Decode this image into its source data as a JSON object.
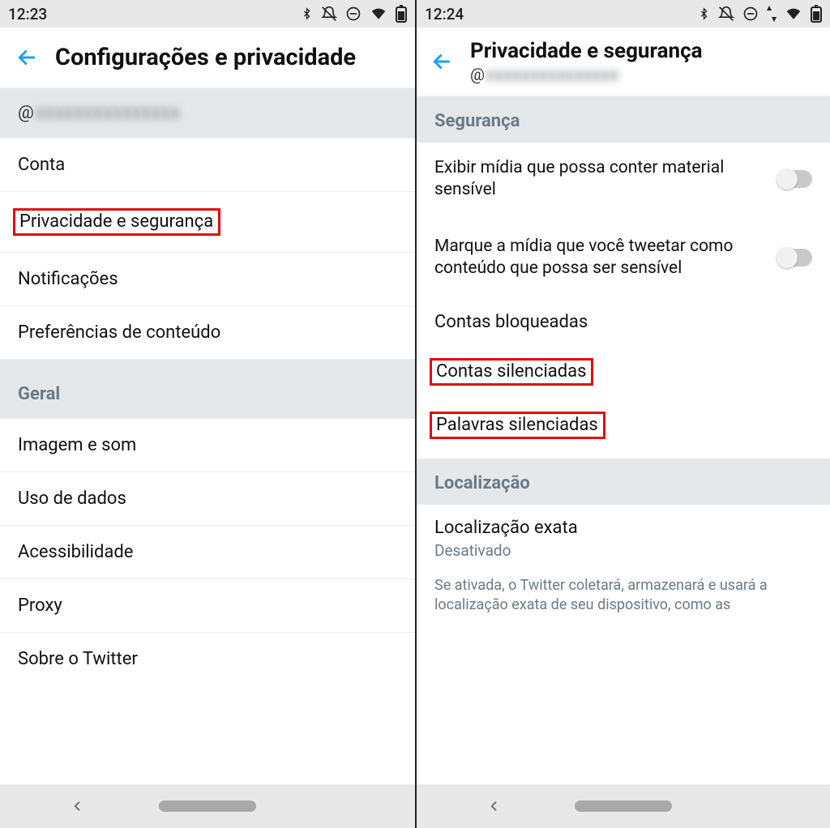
{
  "left": {
    "status_time": "12:23",
    "title": "Configurações e privacidade",
    "username_at": "@",
    "username_blur": "xxxxxxxxxxxxxxx",
    "items": {
      "conta": "Conta",
      "privacidade": "Privacidade e segurança",
      "notificacoes": "Notificações",
      "preferencias": "Preferências de conteúdo"
    },
    "section_geral": "Geral",
    "geral_items": {
      "imagem": "Imagem e som",
      "dados": "Uso de dados",
      "acessibilidade": "Acessibilidade",
      "proxy": "Proxy",
      "sobre": "Sobre o Twitter"
    }
  },
  "right": {
    "status_time": "12:24",
    "title": "Privacidade e segurança",
    "username_at": "@",
    "username_blur": "xxxxxxxxxxxxxxx",
    "section_seguranca": "Segurança",
    "toggle1": "Exibir mídia que possa conter material sensível",
    "toggle2": "Marque a mídia que você tweetar como conteúdo que possa ser sensível",
    "contas_bloqueadas": "Contas bloqueadas",
    "contas_silenciadas": "Contas silenciadas",
    "palavras_silenciadas": "Palavras silenciadas",
    "section_local": "Localização",
    "local_exata": "Localização exata",
    "local_exata_val": "Desativado",
    "local_info": "Se ativada, o Twitter coletará, armazenará e usará a localização exata de seu dispositivo, como as"
  }
}
